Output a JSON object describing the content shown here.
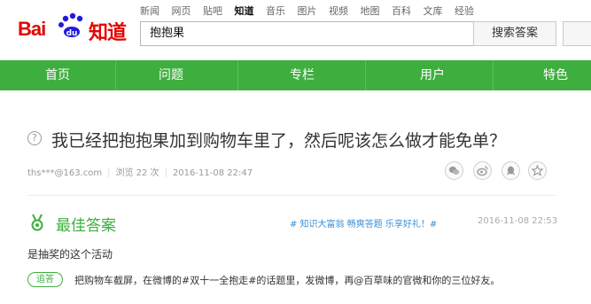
{
  "brand": {
    "logo_left": "Bai",
    "logo_right": "知道",
    "colors": {
      "brand_red": "#e10601",
      "brand_blue": "#2319dc",
      "nav_green": "#3eaf3f",
      "link_blue": "#3c8fd6"
    }
  },
  "top_nav": [
    "新闻",
    "网页",
    "贴吧",
    "知道",
    "音乐",
    "图片",
    "视频",
    "地图",
    "百科",
    "文库",
    "经验"
  ],
  "top_nav_active": "知道",
  "search": {
    "value": "抱抱果",
    "button_label": "搜索答案"
  },
  "main_nav": [
    "首页",
    "问题",
    "专栏",
    "用户",
    "特色"
  ],
  "question": {
    "icon": "question-circle-icon",
    "title": "我已经把抱抱果加到购物车里了，然后呢该怎么做才能免单？",
    "user": "ths***@163.com",
    "views": "浏览 22 次",
    "date": "2016-11-08 22:47",
    "share_icons": [
      "wechat-icon",
      "weibo-icon",
      "qq-icon",
      "favorite-icon"
    ]
  },
  "best_answer": {
    "icon": "medal-icon",
    "title": "最佳答案",
    "tags": "# 知识大富翁 畅爽答题 乐享好礼！#",
    "date": "2016-11-08 22:53",
    "text": "是抽奖的这个活动",
    "followup_label": "追答",
    "followup_text": "把购物车截屏，在微博的#双十一全抱走#的话题里，发微博，再@百草味的官微和你的三位好友。"
  }
}
